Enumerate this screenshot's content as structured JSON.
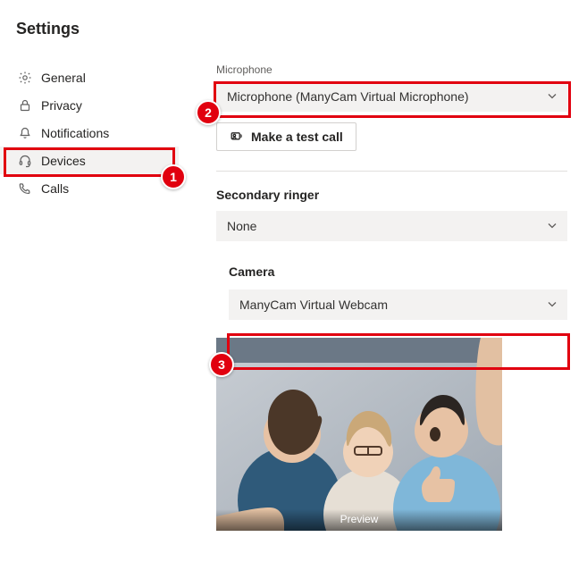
{
  "title": "Settings",
  "sidebar": {
    "items": [
      {
        "label": "General"
      },
      {
        "label": "Privacy"
      },
      {
        "label": "Notifications"
      },
      {
        "label": "Devices"
      },
      {
        "label": "Calls"
      }
    ]
  },
  "microphone": {
    "section_label": "Microphone",
    "selected": "Microphone (ManyCam Virtual Microphone)"
  },
  "test_call_label": "Make a test call",
  "secondary_ringer": {
    "heading": "Secondary ringer",
    "selected": "None"
  },
  "camera": {
    "heading": "Camera",
    "selected": "ManyCam Virtual Webcam",
    "preview_label": "Preview"
  },
  "annotations": {
    "a1": "1",
    "a2": "2",
    "a3": "3"
  }
}
